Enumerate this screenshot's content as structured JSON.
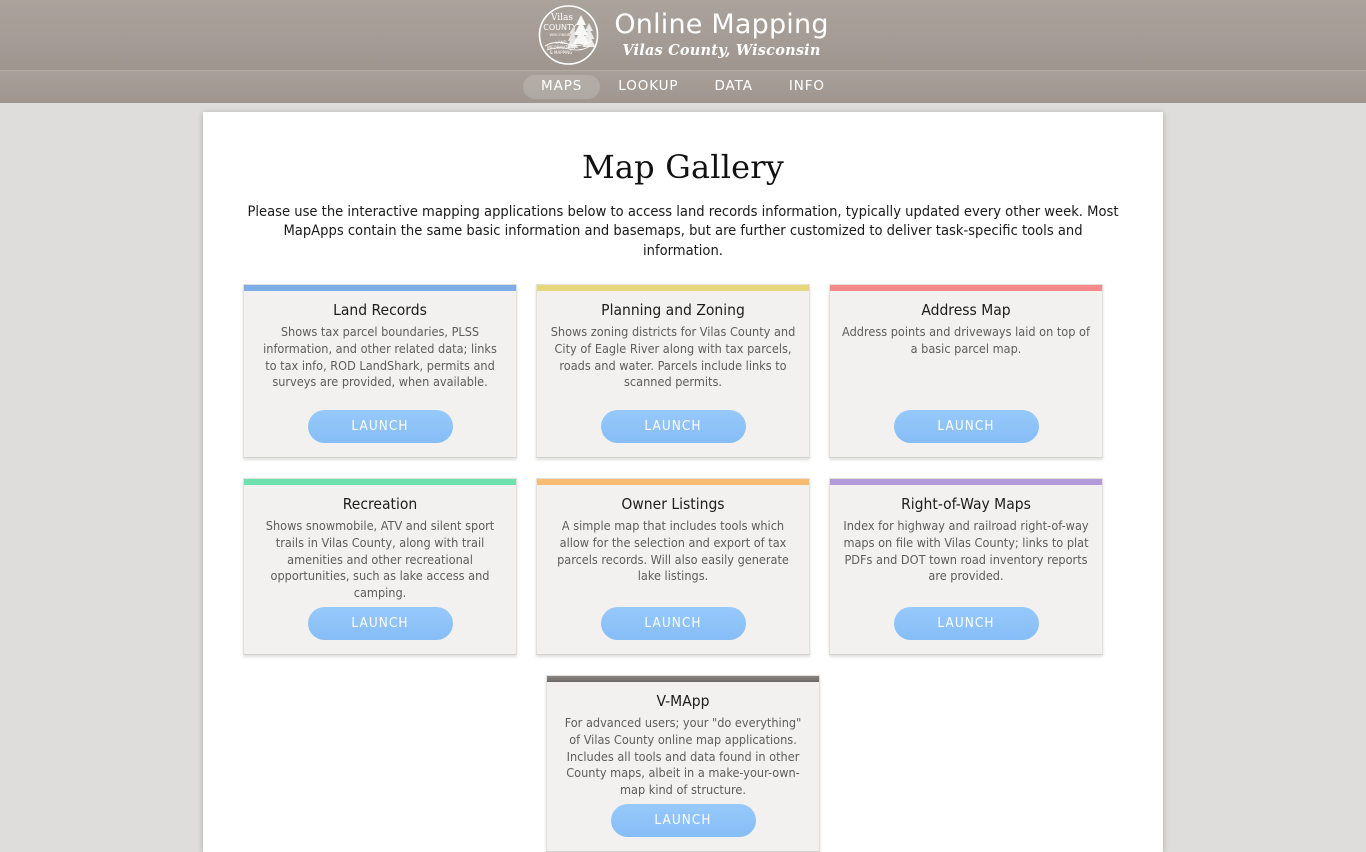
{
  "header": {
    "logo_icon": "vilas-county-seal-icon",
    "logo_text_lines": [
      "Vilas",
      "COUNTY",
      "WISCONSIN",
      "LAND",
      "INFORMATION",
      "& MAPPING"
    ],
    "title": "Online Mapping",
    "subtitle": "Vilas County, Wisconsin",
    "bg_color": "#a49c95"
  },
  "nav": {
    "items": [
      {
        "label": "MAPS",
        "active": true
      },
      {
        "label": "LOOKUP",
        "active": false
      },
      {
        "label": "DATA",
        "active": false
      },
      {
        "label": "INFO",
        "active": false
      }
    ]
  },
  "main": {
    "title": "Map Gallery",
    "intro": "Please use the interactive mapping applications below to access land records information, typically updated every other week. Most MapApps contain the same basic information and basemaps, but are further customized to deliver task-specific tools and information.",
    "launch_label": "LAUNCH",
    "accent_color": "#86bdf6",
    "cards": [
      {
        "title": "Land Records",
        "description": "Shows tax parcel boundaries, PLSS information, and other related data; links to tax info, ROD LandShark, permits and surveys are provided, when available.",
        "bar_color": "#7eaee8",
        "launch_label": "LAUNCH"
      },
      {
        "title": "Planning and Zoning",
        "description": "Shows zoning districts for Vilas County and City of Eagle River along with tax parcels, roads and water. Parcels include links to scanned permits.",
        "bar_color": "#e8d77a",
        "launch_label": "LAUNCH"
      },
      {
        "title": "Address Map",
        "description": "Address points and driveways laid on top of a basic parcel map.",
        "bar_color": "#f58a8a",
        "launch_label": "LAUNCH"
      },
      {
        "title": "Recreation",
        "description": "Shows snowmobile, ATV and silent sport trails in Vilas County, along with trail amenities and other recreational opportunities, such as lake access and camping.",
        "bar_color": "#6fe0b0",
        "launch_label": "LAUNCH"
      },
      {
        "title": "Owner Listings",
        "description": "A simple map that includes tools which allow for the selection and export of tax parcels records. Will also easily generate lake listings.",
        "bar_color": "#f7bb72",
        "launch_label": "LAUNCH"
      },
      {
        "title": "Right-of-Way Maps",
        "description": "Index for highway and railroad right-of-way maps on file with Vilas County; links to plat PDFs and DOT town road inventory reports are provided.",
        "bar_color": "#b49ad8",
        "launch_label": "LAUNCH"
      },
      {
        "title": "V-MApp",
        "description": "For advanced users; your \"do everything\" of Vilas County online map applications. Includes all tools and data found in other County maps, albeit in a make-your-own-map kind of structure.",
        "bar_color": "#74706c",
        "launch_label": "LAUNCH"
      }
    ]
  }
}
